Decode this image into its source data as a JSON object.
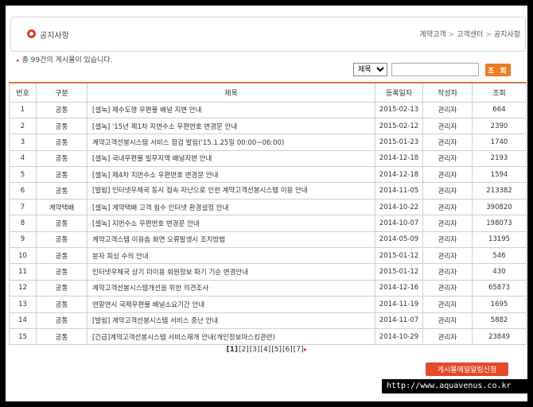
{
  "header": {
    "title": "공지사항",
    "breadcrumb": [
      "계약고객",
      "고객센터",
      "공지사항"
    ]
  },
  "summary": {
    "prefix": "총 ",
    "count": "99건",
    "suffix": "의 게시물이 있습니다."
  },
  "search": {
    "select_value": "제목",
    "input_value": "",
    "button_label": "조 회"
  },
  "table": {
    "columns": [
      "번호",
      "구분",
      "제목",
      "등록일자",
      "작성자",
      "조회"
    ],
    "rows": [
      {
        "no": "1",
        "type": "공통",
        "title": "[셀녹] 제수도행 우편물 배널 지변 안내",
        "date": "2015-02-13",
        "author": "관리자",
        "views": "664"
      },
      {
        "no": "2",
        "type": "공통",
        "title": "[셀녹] '15년 제1차 지번수소 우편번호 변경문 안내",
        "date": "2015-02-12",
        "author": "관리자",
        "views": "2390"
      },
      {
        "no": "3",
        "type": "공통",
        "title": "계약고객선봉시스템 서비스 점검 발림('15.1.25일 00:00~06:00)",
        "date": "2015-01-23",
        "author": "관리자",
        "views": "1740"
      },
      {
        "no": "4",
        "type": "공통",
        "title": "[셀녹] 국내우편물 빌무지역 배널지번 안내",
        "date": "2014-12-18",
        "author": "관리자",
        "views": "2193"
      },
      {
        "no": "5",
        "type": "공통",
        "title": "[셀녹] 제4차 지번수소 우편번호 변경문 안내",
        "date": "2014-12-18",
        "author": "관리자",
        "views": "1594"
      },
      {
        "no": "6",
        "type": "공통",
        "title": "[발림] 인터넷우체국 동시 접속 자난으로 인한 계약고객선봉시스템 이용 안내",
        "date": "2014-11-05",
        "author": "관리자",
        "views": "213382",
        "wrap": true
      },
      {
        "no": "7",
        "type": "계약택배",
        "title": "[셀녹] 계약택배 고객 쉽수 인터넷 환경설정 안내",
        "date": "2014-10-22",
        "author": "관리자",
        "views": "390820"
      },
      {
        "no": "8",
        "type": "공통",
        "title": "[셀녹] 지번수소 우편번호 변경문 안내",
        "date": "2014-10-07",
        "author": "관리자",
        "views": "198073"
      },
      {
        "no": "9",
        "type": "공통",
        "title": "계약고객스템 이용솜 화면 오류발생시 조치방법",
        "date": "2014-05-09",
        "author": "관리자",
        "views": "13195"
      },
      {
        "no": "10",
        "type": "공통",
        "title": "분자 피싱 수의 안내",
        "date": "2015-01-12",
        "author": "관리자",
        "views": "546"
      },
      {
        "no": "11",
        "type": "공통",
        "title": "인터넷우체국 상기 미이용 회원정보 파기 기순 변경안내",
        "date": "2015-01-12",
        "author": "관리자",
        "views": "430"
      },
      {
        "no": "12",
        "type": "공통",
        "title": "계약고객선봉시스템개선을 위한 의견조사",
        "date": "2014-12-16",
        "author": "관리자",
        "views": "65873"
      },
      {
        "no": "13",
        "type": "공통",
        "title": "연말연시 국제우편물 배널소요기간 안내",
        "date": "2014-11-19",
        "author": "관리자",
        "views": "1695"
      },
      {
        "no": "14",
        "type": "공통",
        "title": "[발림] 계약고객선봉시스템 서비스 중난 안내",
        "date": "2014-11-07",
        "author": "관리자",
        "views": "5882"
      },
      {
        "no": "15",
        "type": "공통",
        "title": "[긴급]계약고객선봉시스템 서비스재개 안내(개인정보마스킹관련)",
        "date": "2014-10-29",
        "author": "관리자",
        "views": "23849"
      }
    ]
  },
  "pagination": {
    "pages": [
      "[1]",
      "[2]",
      "[3]",
      "[4]",
      "[5]",
      "[6]",
      "[7]"
    ],
    "current": "[1]",
    "next": "▸"
  },
  "mail_button": "게시물메일알림신청",
  "watermark": "http://www.aquavenus.co.kr",
  "colors": {
    "accent": "#e03a1c",
    "button": "#f07a20",
    "border": "#cfcfcf"
  }
}
